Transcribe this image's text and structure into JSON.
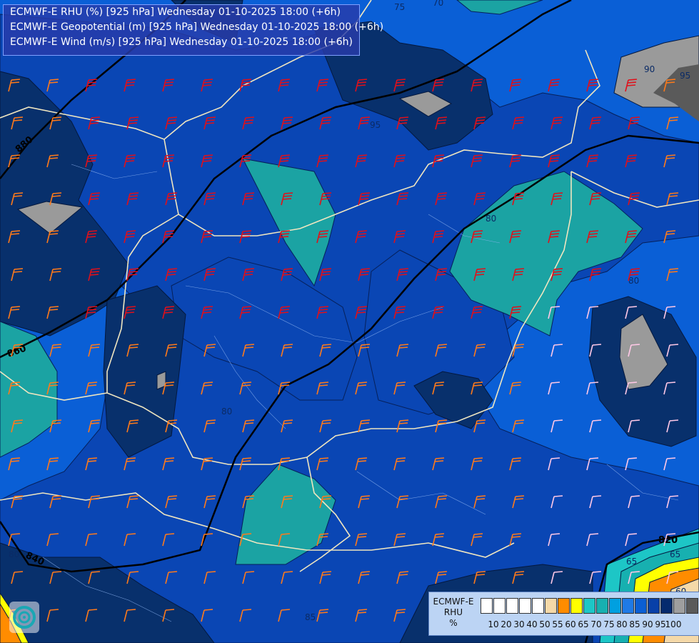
{
  "title_lines": [
    "ECMWF-E RHU (%) [925 hPa] Wednesday 01-10-2025 18:00 (+6h)",
    "ECMWF-E Geopotential (m) [925 hPa] Wednesday 01-10-2025 18:00 (+6h)",
    "ECMWF-E Wind (m/s) [925 hPa] Wednesday 01-10-2025 18:00 (+6h)"
  ],
  "legend": {
    "label_lines": [
      "ECMWF-E",
      "RHU",
      "%"
    ],
    "ticks": [
      "10",
      "20",
      "30",
      "40",
      "50",
      "55",
      "60",
      "65",
      "70",
      "75",
      "80",
      "85",
      "90",
      "95",
      "100"
    ],
    "colors": [
      "#ffffff",
      "#ffffff",
      "#ffffff",
      "#ffffff",
      "#ffffff",
      "#f5d9a8",
      "#ff8c00",
      "#ffff00",
      "#1dc6c6",
      "#17b0b0",
      "#00a0e0",
      "#1f7ae6",
      "#0b5fd4",
      "#0840a8",
      "#052a6e",
      "#9e9e9e",
      "#5a5a5a"
    ]
  },
  "geopotential_labels": [
    "880",
    "860",
    "840",
    "820"
  ],
  "rhu_contour_labels": [
    "75",
    "70",
    "90",
    "95",
    "95",
    "80",
    "80",
    "80",
    "80",
    "85",
    "65",
    "60",
    "65"
  ],
  "colors": {
    "rh_80": "#0a5fd6",
    "rh_85": "#0a46b4",
    "rh_90": "#08306c",
    "rh_75": "#1ba3a3",
    "rh_95": "#9a9a9a",
    "title_bg": "#2a3ca8",
    "wind_red": "#e0101a",
    "wind_orange": "#ff7a1a",
    "wind_pink": "#ffc8e6",
    "border": "#f0e6c0"
  },
  "logo": {
    "icon": "meteo-swirl-logo"
  }
}
